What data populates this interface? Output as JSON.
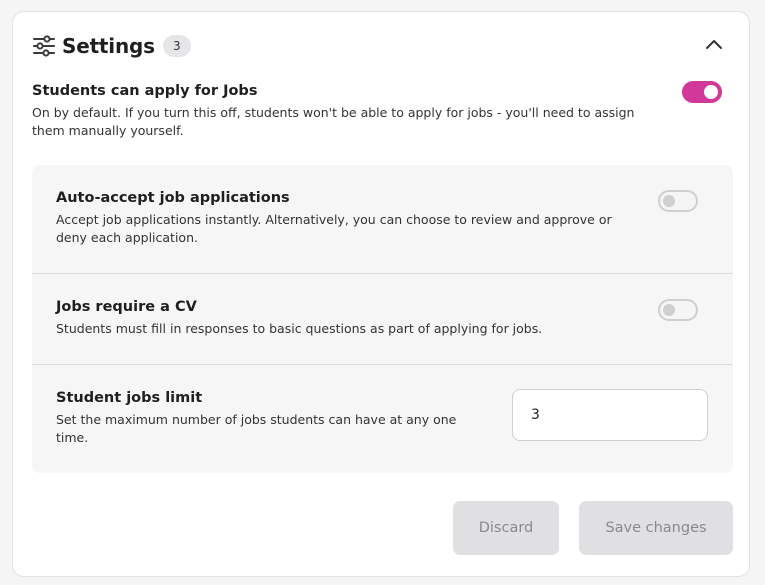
{
  "header": {
    "title": "Settings",
    "count": "3",
    "icon": "sliders-icon",
    "collapse_icon": "chevron-up-icon"
  },
  "main_setting": {
    "title": "Students can apply for Jobs",
    "description": "On by default. If you turn this off, students won't be able to apply for jobs - you'll need to assign them manually yourself.",
    "enabled": true
  },
  "sub_settings": [
    {
      "title": "Auto-accept job applications",
      "description": "Accept job applications instantly. Alternatively, you can choose to review and approve or deny each application.",
      "enabled": false
    },
    {
      "title": "Jobs require a CV",
      "description": "Students must fill in responses to basic questions as part of applying for jobs.",
      "enabled": false
    },
    {
      "title": "Student jobs limit",
      "description": "Set the maximum number of jobs students can have at any one time.",
      "value": "3"
    }
  ],
  "actions": {
    "discard_label": "Discard",
    "save_label": "Save changes"
  },
  "colors": {
    "accent": "#d2379a",
    "disabled_button_bg": "#e0e0e2",
    "disabled_button_text": "#8a8a8d",
    "panel_bg": "#f6f6f7"
  }
}
